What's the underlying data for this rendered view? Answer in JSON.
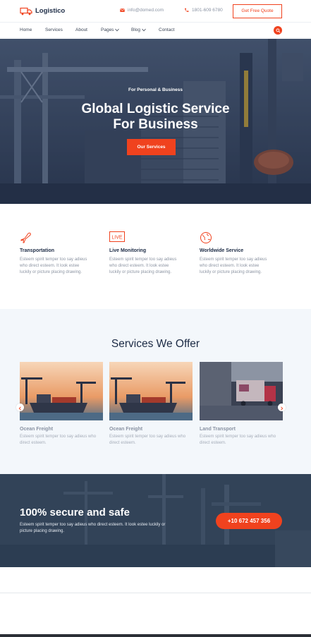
{
  "header": {
    "brand": "Logistico",
    "email": "info@domed.com",
    "phone": "1801-609 6780",
    "quote_label": "Get Free Quote"
  },
  "nav": {
    "items": [
      "Home",
      "Services",
      "About",
      "Pages",
      "Blog",
      "Contact"
    ]
  },
  "hero": {
    "overline": "For Personal & Business",
    "title_line1": "Global Logistic Service",
    "title_line2": "For Business",
    "button": "Our Services"
  },
  "features": [
    {
      "icon": "plane-icon",
      "title": "Transportation",
      "text": "Esteem spirit temper too say adieus who direct esteem. It look estee luckily or picture placing drawing."
    },
    {
      "icon": "live-icon",
      "title": "Live Monitoring",
      "text": "Esteem spirit temper too say adieus who direct esteem. It look estee luckily or picture placing drawing."
    },
    {
      "icon": "globe-icon",
      "title": "Worldwide Service",
      "text": "Esteem spirit temper too say adieus who direct esteem. It look estee luckily or picture placing drawing."
    }
  ],
  "services": {
    "title": "Services We Offer",
    "cards": [
      {
        "title": "Ocean Freight",
        "text": "Esteem spirit temper too say adieus who direct esteem."
      },
      {
        "title": "Ocean Freight",
        "text": "Esteem spirit temper too say adieus who direct esteem."
      },
      {
        "title": "Land Transport",
        "text": "Esteem spirit temper too say adieus who direct esteem."
      }
    ]
  },
  "cta": {
    "title": "100% secure and safe",
    "text": "Esteem spirit temper too say adieus who direct esteem. It look estee luckily or picture placing drawing.",
    "phone": "+10 672 457 356"
  },
  "colors": {
    "accent": "#f0421e",
    "navy": "#1c2b45",
    "services_bg": "#f3f7fb"
  }
}
